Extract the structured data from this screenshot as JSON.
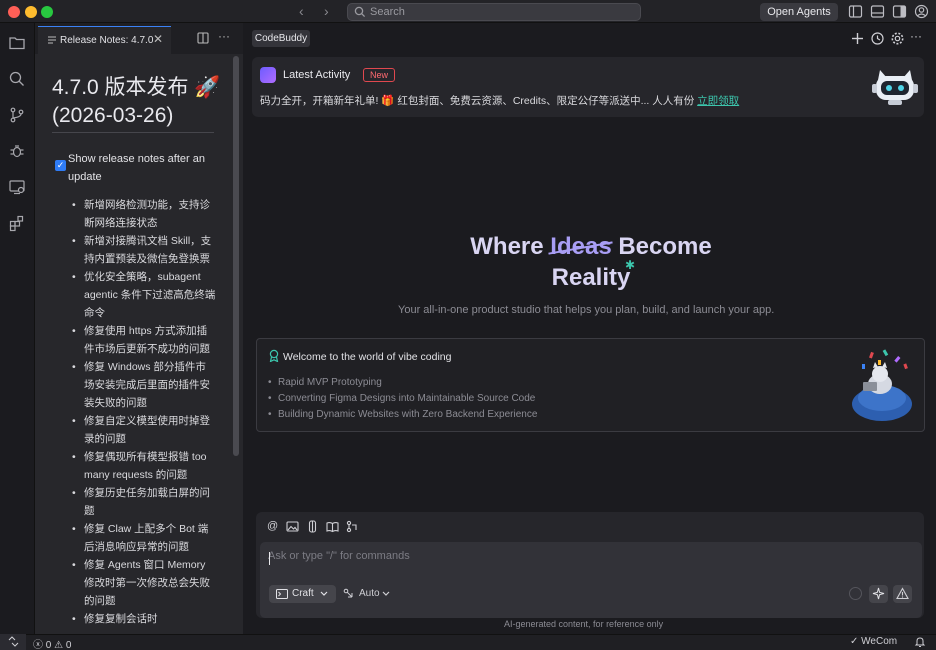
{
  "window": {
    "search_placeholder": "Search",
    "open_agents_label": "Open Agents"
  },
  "release_notes": {
    "tab_label": "Release Notes: 4.7.0",
    "title_line1": "4.7.0 版本发布 🚀",
    "title_line2": "(2026-03-26)",
    "checkbox_label": "Show release notes after an update",
    "checkbox_checked": true,
    "items": [
      "新增网络检测功能，支持诊断网络连接状态",
      "新增对接腾讯文档 Skill，支持内置预装及微信免登换票",
      "优化安全策略，subagent agentic 条件下过滤高危终端命令",
      "修复使用 https 方式添加插件市场后更新不成功的问题",
      "修复 Windows 部分插件市场安装完成后里面的插件安装失败的问题",
      "修复自定义模型使用时掉登录的问题",
      "修复偶现所有模型报错 too many requests 的问题",
      "修复历史任务加载白屏的问题",
      "修复 Claw 上配多个 Bot 端后消息响应异常的问题",
      "修复 Agents 窗口 Memory 修改时第一次修改总会失败的问题",
      "修复复制会话时"
    ]
  },
  "main": {
    "tab_label": "CodeBuddy",
    "activity": {
      "title": "Latest Activity",
      "badge": "New",
      "text": "码力全开，开箱新年礼单! 🎁 红包封面、免费云资源、Credits、限定公仔等派送中... 人人有份 ",
      "link": "立即领取"
    },
    "headline": {
      "word1": "Where",
      "word2": "Ideas",
      "word3": "Become",
      "line2": "Reality"
    },
    "subtitle": "Your all-in-one product studio that helps you plan, build, and launch your app.",
    "welcome": {
      "title": "Welcome to the world of vibe coding",
      "items": [
        "Rapid MVP Prototyping",
        "Converting Figma Designs into Maintainable Source Code",
        "Building Dynamic Websites with Zero Backend Experience"
      ]
    },
    "composer": {
      "placeholder": "Ask or type \"/\" for commands",
      "mode_label": "Craft",
      "model_label": "Auto"
    },
    "disclaimer": "AI-generated content, for reference only"
  },
  "statusbar": {
    "errors": "0",
    "warnings": "0",
    "wecom_label": "WeCom"
  },
  "colors": {
    "accent_blue": "#2f7cf6",
    "accent_teal": "#3cc6ad",
    "badge_red": "#e0484f",
    "headline_purple": "#a99ef5"
  }
}
